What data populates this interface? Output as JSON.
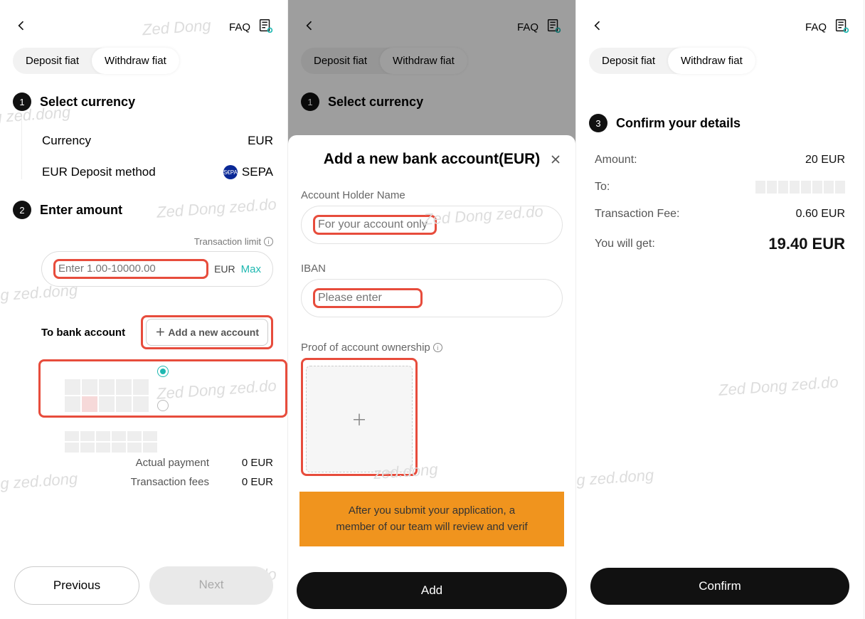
{
  "common": {
    "faq": "FAQ",
    "tabs": {
      "deposit": "Deposit fiat",
      "withdraw": "Withdraw fiat"
    }
  },
  "p1": {
    "step1": {
      "title": "Select currency",
      "currency_lbl": "Currency",
      "currency_val": "EUR",
      "method_lbl": "EUR Deposit method",
      "method_val": "SEPA",
      "sepa_badge": "S€PA"
    },
    "step2": {
      "title": "Enter amount",
      "tx_limit_lbl": "Transaction limit",
      "amount_placeholder": "Enter 1.00-10000.00",
      "ccy": "EUR",
      "max": "Max",
      "to_bank_lbl": "To bank account",
      "add_acc_btn": "Add a new account"
    },
    "totals": {
      "actual_lbl": "Actual payment",
      "actual_val": "0 EUR",
      "fee_lbl": "Transaction fees",
      "fee_val": "0 EUR"
    },
    "prev_btn": "Previous",
    "next_btn": "Next"
  },
  "p2": {
    "sheet_title": "Add a new bank account(EUR)",
    "holder_lbl": "Account Holder Name",
    "holder_placeholder": "For your account only",
    "iban_lbl": "IBAN",
    "iban_placeholder": "Please enter",
    "proof_lbl": "Proof of account ownership",
    "notice": "After you submit your application, a member of our team will review and verif",
    "add_btn": "Add"
  },
  "p3": {
    "step3_title": "Confirm your details",
    "amount_lbl": "Amount:",
    "amount_val": "20 EUR",
    "to_lbl": "To:",
    "fee_lbl": "Transaction Fee:",
    "fee_val": "0.60 EUR",
    "get_lbl": "You will get:",
    "get_val": "19.40 EUR",
    "confirm_btn": "Confirm"
  }
}
